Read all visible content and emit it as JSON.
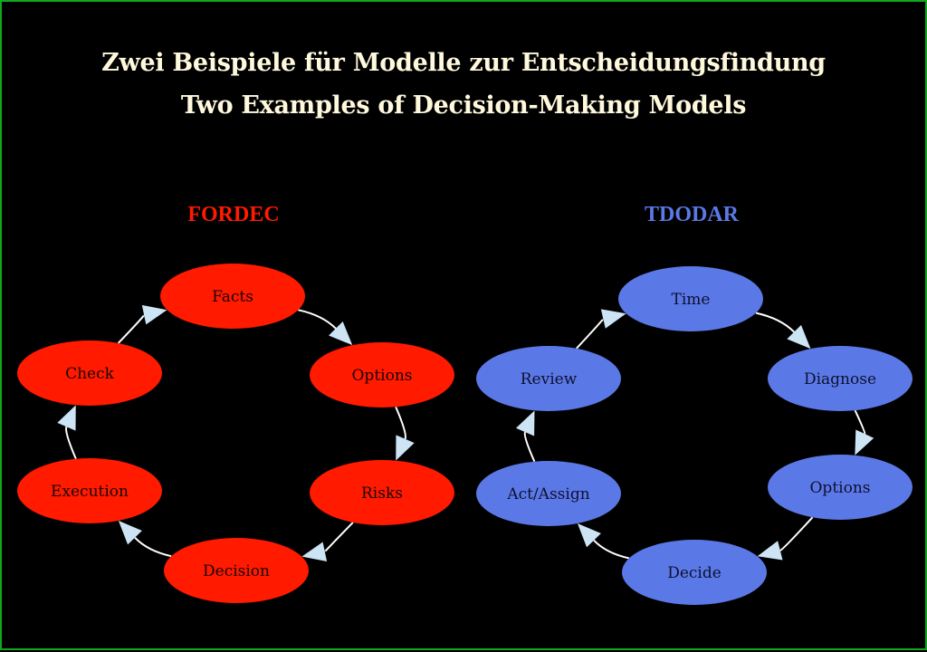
{
  "title": {
    "line1": "Zwei Beispiele für Modelle zur Entscheidungsfindung",
    "line2": "Two Examples of Decision-Making Models"
  },
  "colors": {
    "border": "#0fa81f",
    "background": "#000000",
    "title_text": "#fff8dc",
    "edge_line": "#ffffff",
    "arrowhead": "#cce4f4"
  },
  "models": [
    {
      "name": "FORDEC",
      "color": "#ff1a00",
      "label_color": "#ff1a00",
      "text_color": "#1a0604",
      "nodes": [
        "Facts",
        "Options",
        "Risks",
        "Decision",
        "Execution",
        "Check"
      ],
      "edges": [
        [
          "Facts",
          "Options"
        ],
        [
          "Options",
          "Risks"
        ],
        [
          "Risks",
          "Decision"
        ],
        [
          "Decision",
          "Execution"
        ],
        [
          "Execution",
          "Check"
        ],
        [
          "Check",
          "Facts"
        ]
      ]
    },
    {
      "name": "TDODAR",
      "color": "#5b79e6",
      "label_color": "#5b79e6",
      "text_color": "#0d1030",
      "nodes": [
        "Time",
        "Diagnose",
        "Options",
        "Decide",
        "Act/Assign",
        "Review"
      ],
      "edges": [
        [
          "Time",
          "Diagnose"
        ],
        [
          "Diagnose",
          "Options"
        ],
        [
          "Options",
          "Decide"
        ],
        [
          "Decide",
          "Act/Assign"
        ],
        [
          "Act/Assign",
          "Review"
        ],
        [
          "Review",
          "Time"
        ]
      ]
    }
  ]
}
